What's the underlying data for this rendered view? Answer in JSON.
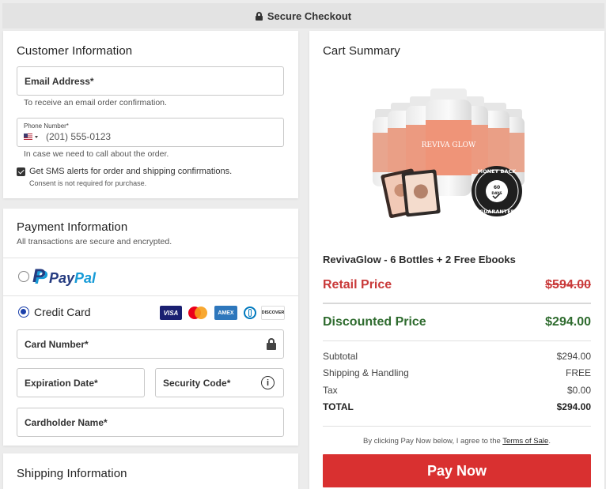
{
  "header": {
    "title": "Secure Checkout"
  },
  "customer": {
    "title": "Customer Information",
    "email_label": "Email Address*",
    "email_hint": "To receive an email order confirmation.",
    "phone_label": "Phone Number*",
    "phone_placeholder": "(201) 555-0123",
    "phone_hint": "In case we need to call about the order.",
    "sms_label": "Get SMS alerts for order and shipping confirmations.",
    "sms_checked": true,
    "sms_note": "Consent is not required for purchase."
  },
  "payment": {
    "title": "Payment Information",
    "subtitle": "All transactions are secure and encrypted.",
    "paypal_pay": "Pay",
    "paypal_pal": "Pal",
    "credit_card_label": "Credit Card",
    "card_logos": [
      "VISA",
      "Mastercard",
      "AMEX",
      "Diners",
      "DISCOVER"
    ],
    "card_number_label": "Card Number*",
    "expiration_label": "Expiration Date*",
    "security_label": "Security Code*",
    "cardholder_label": "Cardholder Name*"
  },
  "shipping": {
    "title": "Shipping Information"
  },
  "cart": {
    "title": "Cart Summary",
    "product_name": "RevivaGlow - 6 Bottles + 2 Free Ebooks",
    "bottle_label": "REVIVA GLOW",
    "badge_line1": "MONEY BACK",
    "badge_days": "60",
    "badge_days_label": "DAYS",
    "badge_line2": "GUARANTEE",
    "retail_label": "Retail Price",
    "retail_value": "$594.00",
    "discount_label": "Discounted Price",
    "discount_value": "$294.00",
    "rows": [
      {
        "label": "Subtotal",
        "value": "$294.00"
      },
      {
        "label": "Shipping & Handling",
        "value": "FREE"
      },
      {
        "label": "Tax",
        "value": "$0.00"
      },
      {
        "label": "TOTAL",
        "value": "$294.00"
      }
    ],
    "terms_prefix": "By clicking Pay Now below, I agree to the ",
    "terms_link": "Terms of Sale",
    "terms_suffix": ".",
    "pay_button": "Pay Now"
  },
  "colors": {
    "accent_red": "#d93030",
    "retail_red": "#c93a3a",
    "discount_green": "#2e6b2e",
    "radio_blue": "#1a3faa",
    "paypal_dark": "#253b80",
    "paypal_light": "#179bd7"
  }
}
